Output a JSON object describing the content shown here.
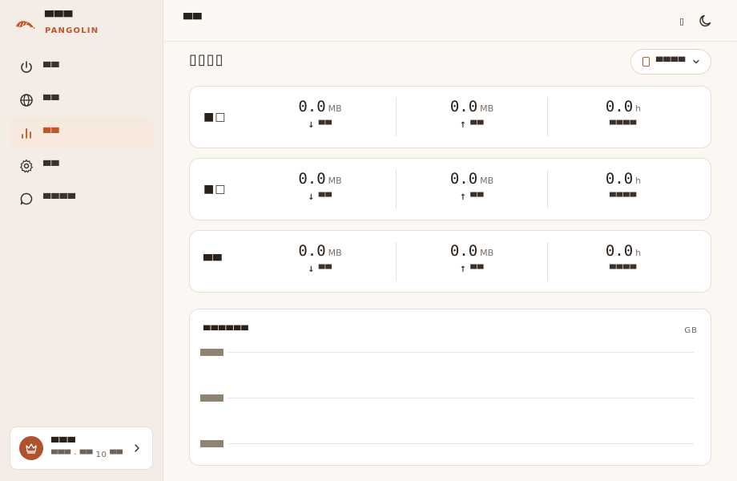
{
  "brand": {
    "title": "▀▀▀",
    "subtitle": "PANGOLIN"
  },
  "nav": [
    {
      "id": "power",
      "icon": "power-icon",
      "label": "▀▀"
    },
    {
      "id": "globe",
      "icon": "globe-icon",
      "label": "▀▀"
    },
    {
      "id": "stats",
      "icon": "bar-chart-icon",
      "label": "▀▀",
      "active": true
    },
    {
      "id": "settings",
      "icon": "gear-icon",
      "label": "▀▀"
    },
    {
      "id": "feedback",
      "icon": "chat-icon",
      "label": "▀▀▀▀"
    }
  ],
  "account": {
    "name": "▀▀▀",
    "plan": "▀▀▀ · ▀▀ 10 ▀▀"
  },
  "topbar": {
    "title": "▀▀",
    "lang_icon": "▯"
  },
  "section": {
    "title": "▯▯▯▯"
  },
  "device_select": {
    "value": "▀▀▀▀"
  },
  "stats": [
    {
      "label": "■□",
      "down": {
        "value": "0.0",
        "unit": "MB",
        "label": "↓ ▀▀"
      },
      "up": {
        "value": "0.0",
        "unit": "MB",
        "label": "↑ ▀▀"
      },
      "time": {
        "value": "0.0",
        "unit": "h",
        "label": "▀▀▀▀"
      }
    },
    {
      "label": "■□",
      "down": {
        "value": "0.0",
        "unit": "MB",
        "label": "↓ ▀▀"
      },
      "up": {
        "value": "0.0",
        "unit": "MB",
        "label": "↑ ▀▀"
      },
      "time": {
        "value": "0.0",
        "unit": "h",
        "label": "▀▀▀▀"
      }
    },
    {
      "label": "▀▀",
      "down": {
        "value": "0.0",
        "unit": "MB",
        "label": "↓ ▀▀"
      },
      "up": {
        "value": "0.0",
        "unit": "MB",
        "label": "↑ ▀▀"
      },
      "time": {
        "value": "0.0",
        "unit": "h",
        "label": "▀▀▀▀"
      }
    }
  ],
  "chart": {
    "title": "▀▀▀▀▀▀",
    "unit": "GB",
    "gridlines": 3
  },
  "colors": {
    "accent": "#c0562a",
    "active_bg": "#f8e9df",
    "sidebar_bg": "#f3ede6",
    "page_bg": "#fbf8f4"
  }
}
